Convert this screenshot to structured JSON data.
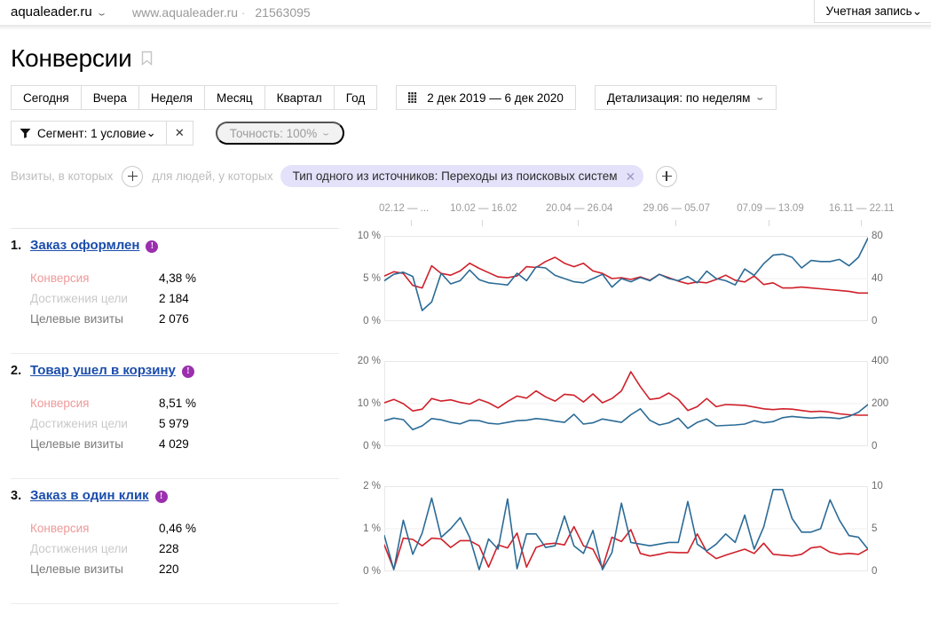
{
  "topbar": {
    "site_name": "aqualeader.ru",
    "site_url": "www.aqualeader.ru",
    "separator": "·",
    "counter_id": "21563095",
    "account_label": "Учетная запись",
    "chevron": "⌄"
  },
  "header": {
    "title": "Конверсии",
    "bookmark_icon": "bookmark-icon"
  },
  "period_buttons": [
    {
      "label": "Сегодня"
    },
    {
      "label": "Вчера"
    },
    {
      "label": "Неделя"
    },
    {
      "label": "Месяц"
    },
    {
      "label": "Квартал"
    },
    {
      "label": "Год"
    }
  ],
  "date_range": {
    "icon": "calendar-grid-icon",
    "label": "2 дек 2019 — 6 дек 2020"
  },
  "detail_select": {
    "label": "Детализация: по неделям",
    "chevron": "⌄"
  },
  "segment": {
    "icon": "funnel-icon",
    "label": "Сегмент: 1 условие",
    "chevron": "⌄",
    "close_icon": "close-icon",
    "close_glyph": "✕"
  },
  "accuracy": {
    "label": "Точность: 100%",
    "chevron": "⌄"
  },
  "conditions": {
    "visits_label": "Визиты, в которых",
    "people_label": "для людей, у которых",
    "add_icon": "plus-icon",
    "chip": {
      "label": "Тип одного из источников: Переходы из поисковых систем",
      "remove_glyph": "✕"
    }
  },
  "xaxis": {
    "ticks": [
      {
        "label": "02.12 — ...",
        "pos": 0.055
      },
      {
        "label": "10.02 — 16.02",
        "pos": 0.202
      },
      {
        "label": "20.04 — 26.04",
        "pos": 0.4
      },
      {
        "label": "29.06 — 05.07",
        "pos": 0.601
      },
      {
        "label": "07.09 — 13.09",
        "pos": 0.795
      },
      {
        "label": "16.11 — 22.11",
        "pos": 0.985
      }
    ]
  },
  "metric_labels": {
    "conversion": "Конверсия",
    "goal_reaches": "Достижения цели",
    "target_visits": "Целевые визиты"
  },
  "colors": {
    "series_conversion": "#d0202a",
    "series_visits": "#2b6b96",
    "goal_link": "#1a4dab",
    "badge": "#9b2fae",
    "chip_bg": "#e4e2fa"
  },
  "goals": [
    {
      "num": "1.",
      "name": "Заказ оформлен",
      "badge": "!",
      "conversion": "4,38 %",
      "goal_reaches": "2 184",
      "target_visits": "2 076"
    },
    {
      "num": "2.",
      "name": "Товар ушел в корзину",
      "badge": "!",
      "conversion": "8,51 %",
      "goal_reaches": "5 979",
      "target_visits": "4 029"
    },
    {
      "num": "3.",
      "name": "Заказ в один клик",
      "badge": "!",
      "conversion": "0,46 %",
      "goal_reaches": "228",
      "target_visits": "220"
    }
  ],
  "chart_data": [
    {
      "type": "line",
      "title": "Заказ оформлен",
      "xlabel": "",
      "x": [
        "02.12 — ...",
        "10.02 — 16.02",
        "20.04 — 26.04",
        "29.06 — 05.07",
        "07.09 — 13.09",
        "16.11 — 22.11"
      ],
      "left_axis": {
        "label": "%",
        "ticks": [
          "0 %",
          "5 %",
          "10 %"
        ],
        "ylim": [
          0,
          10
        ]
      },
      "right_axis": {
        "label": "",
        "ticks": [
          "0",
          "40",
          "80"
        ],
        "ylim": [
          0,
          80
        ]
      },
      "grid": true,
      "legend": "none",
      "series": [
        {
          "name": "Конверсия",
          "color": "#d0202a",
          "axis": "left",
          "values": [
            5.3,
            5.8,
            5.6,
            4.2,
            3.9,
            6.5,
            5.6,
            5.4,
            5.9,
            6.8,
            6.2,
            5.7,
            5.2,
            5.1,
            5.3,
            6.4,
            6.3,
            7.0,
            7.5,
            6.8,
            6.4,
            6.8,
            5.9,
            5.6,
            5.0,
            5.1,
            4.9,
            5.2,
            4.8,
            5.5,
            5.1,
            4.7,
            4.4,
            4.6,
            4.5,
            4.9,
            5.4,
            4.8,
            4.6,
            5.3,
            4.3,
            4.5,
            3.9,
            3.9,
            4.0,
            3.9,
            3.8,
            3.7,
            3.6,
            3.5,
            3.3,
            3.3
          ]
        },
        {
          "name": "Целевые визиты",
          "color": "#2b6b96",
          "axis": "right",
          "values": [
            38,
            44,
            46,
            42,
            10,
            18,
            45,
            35,
            38,
            48,
            39,
            36,
            35,
            34,
            45,
            38,
            51,
            50,
            43,
            40,
            37,
            36,
            40,
            44,
            32,
            40,
            37,
            41,
            38,
            44,
            40,
            38,
            42,
            36,
            47,
            40,
            38,
            34,
            49,
            43,
            54,
            62,
            63,
            60,
            50,
            57,
            56,
            56,
            58,
            52,
            60,
            78
          ]
        }
      ]
    },
    {
      "type": "line",
      "title": "Товар ушел в корзину",
      "xlabel": "",
      "x": [
        "02.12 — ...",
        "10.02 — 16.02",
        "20.04 — 26.04",
        "29.06 — 05.07",
        "07.09 — 13.09",
        "16.11 — 22.11"
      ],
      "left_axis": {
        "label": "%",
        "ticks": [
          "0 %",
          "10 %",
          "20 %"
        ],
        "ylim": [
          0,
          20
        ]
      },
      "right_axis": {
        "label": "",
        "ticks": [
          "0",
          "200",
          "400"
        ],
        "ylim": [
          0,
          400
        ]
      },
      "grid": true,
      "legend": "none",
      "series": [
        {
          "name": "Конверсия",
          "color": "#d0202a",
          "axis": "left",
          "values": [
            10.2,
            11.0,
            10.0,
            8.3,
            8.7,
            11.2,
            10.6,
            10.9,
            10.3,
            9.9,
            11.0,
            10.2,
            9.0,
            10.5,
            11.8,
            11.3,
            13.0,
            11.6,
            10.6,
            12.2,
            12.0,
            10.4,
            12.3,
            10.2,
            11.2,
            13.0,
            17.5,
            14.0,
            11.0,
            11.3,
            12.5,
            11.0,
            8.4,
            9.3,
            11.2,
            9.3,
            9.8,
            9.7,
            9.6,
            9.2,
            8.8,
            8.6,
            8.8,
            8.7,
            8.4,
            8.1,
            8.2,
            8.0,
            7.6,
            7.4,
            7.3,
            7.3
          ]
        },
        {
          "name": "Целевые визиты",
          "color": "#2b6b96",
          "axis": "right",
          "values": [
            120,
            132,
            125,
            78,
            96,
            130,
            124,
            112,
            105,
            122,
            120,
            108,
            104,
            112,
            120,
            122,
            130,
            126,
            118,
            112,
            150,
            104,
            110,
            128,
            120,
            112,
            148,
            176,
            122,
            100,
            110,
            132,
            84,
            112,
            128,
            96,
            98,
            100,
            104,
            120,
            110,
            116,
            134,
            140,
            136,
            132,
            136,
            134,
            130,
            140,
            160,
            196
          ]
        }
      ]
    },
    {
      "type": "line",
      "title": "Заказ в один клик",
      "xlabel": "",
      "x": [
        "02.12 — ...",
        "10.02 — 16.02",
        "20.04 — 26.04",
        "29.06 — 05.07",
        "07.09 — 13.09",
        "16.11 — 22.11"
      ],
      "left_axis": {
        "label": "%",
        "ticks": [
          "0 %",
          "1 %",
          "2 %"
        ],
        "ylim": [
          0,
          2
        ]
      },
      "right_axis": {
        "label": "",
        "ticks": [
          "0",
          "5",
          "10"
        ],
        "ylim": [
          0,
          10
        ]
      },
      "grid": true,
      "legend": "none",
      "series": [
        {
          "name": "Конверсия",
          "color": "#d0202a",
          "axis": "left",
          "values": [
            0.62,
            0.05,
            0.78,
            0.75,
            0.6,
            0.78,
            0.76,
            0.56,
            0.72,
            0.72,
            0.6,
            0.1,
            0.62,
            0.55,
            0.9,
            0.1,
            0.56,
            0.64,
            0.66,
            0.62,
            1.05,
            0.6,
            0.52,
            0.08,
            0.8,
            0.7,
            0.98,
            0.42,
            0.36,
            0.4,
            0.45,
            0.44,
            0.44,
            0.88,
            0.46,
            0.3,
            0.38,
            0.45,
            0.52,
            0.42,
            0.66,
            0.4,
            0.38,
            0.36,
            0.4,
            0.55,
            0.58,
            0.45,
            0.4,
            0.42,
            0.4,
            0.52
          ]
        },
        {
          "name": "Целевые визиты",
          "color": "#2b6b96",
          "axis": "right",
          "values": [
            4.2,
            0.2,
            6.0,
            2.0,
            4.5,
            8.6,
            4.0,
            5.0,
            6.3,
            4.0,
            0.2,
            3.8,
            2.6,
            8.5,
            0.3,
            4.4,
            4.4,
            2.8,
            3.0,
            6.5,
            3.0,
            2.1,
            4.8,
            0.2,
            2.2,
            8.0,
            3.4,
            3.2,
            3.0,
            3.2,
            3.4,
            3.4,
            8.2,
            3.2,
            2.4,
            3.2,
            4.4,
            3.4,
            6.6,
            2.6,
            5.2,
            9.6,
            9.6,
            6.2,
            4.6,
            4.6,
            5.0,
            8.4,
            6.0,
            4.2,
            4.0,
            2.6
          ]
        }
      ]
    }
  ]
}
